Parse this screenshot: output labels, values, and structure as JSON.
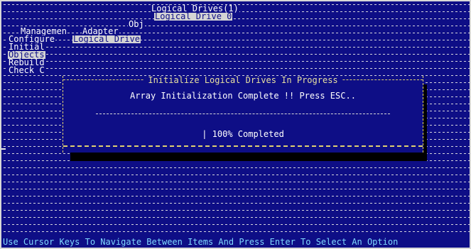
{
  "window": {
    "breadcrumb_top": "Logical Drives(1)",
    "breadcrumb_selected": "Logical Drive 0",
    "breadcrumb_obj": "Obj"
  },
  "menu": {
    "management_label": "Managemen",
    "adapter_label": "Adapter",
    "configure_label": "Configure",
    "logical_drive_label": "Logical Drive",
    "items": [
      {
        "label": "Initial"
      },
      {
        "label": "Objects"
      },
      {
        "label": "Rebuild"
      },
      {
        "label": "Check C"
      }
    ]
  },
  "dialog": {
    "title": "Initialize Logical Drives In Progress",
    "message": "Array Initialization Complete !! Press ESC..",
    "progress_percent": 100,
    "progress_text": "| 100% Completed"
  },
  "status_bar": {
    "hint": "Use Cursor Keys To Navigate Between Items And Press Enter To Select An Option"
  },
  "colors": {
    "background": "#0e0e86",
    "dialog_border": "#e0d070",
    "highlight": "#d4d4d4",
    "hint_text": "#7fd8ff"
  }
}
